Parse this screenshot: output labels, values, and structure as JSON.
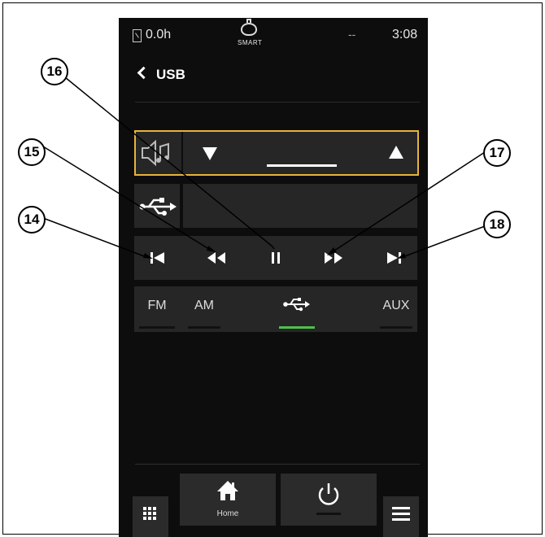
{
  "status": {
    "hour_meter": "0.0h",
    "smart_label": "SMART",
    "signal": "--",
    "clock": "3:08"
  },
  "header": {
    "title": "USB"
  },
  "icons": {
    "volume": "speaker-music-icon",
    "vol_down": "triangle-down-icon",
    "vol_up": "triangle-up-icon",
    "usb": "usb-icon",
    "grid": "grid-icon",
    "home": "home-icon",
    "power": "power-icon",
    "menu": "hamburger-icon"
  },
  "transport": [
    "previous-track",
    "rewind",
    "pause",
    "fast-forward",
    "next-track"
  ],
  "tabs": [
    {
      "label": "FM",
      "active": false
    },
    {
      "label": "AM",
      "active": false
    },
    {
      "label": "usb",
      "active": true
    },
    {
      "label": "AUX",
      "active": false
    }
  ],
  "bottom": {
    "home_label": "Home"
  },
  "callouts": {
    "c14": "14",
    "c15": "15",
    "c16": "16",
    "c17": "17",
    "c18": "18"
  },
  "colors": {
    "screen_bg": "#0d0d0d",
    "button_bg": "#262626",
    "focus_border": "#e7b33a",
    "active_tab": "#4fbf4a"
  }
}
